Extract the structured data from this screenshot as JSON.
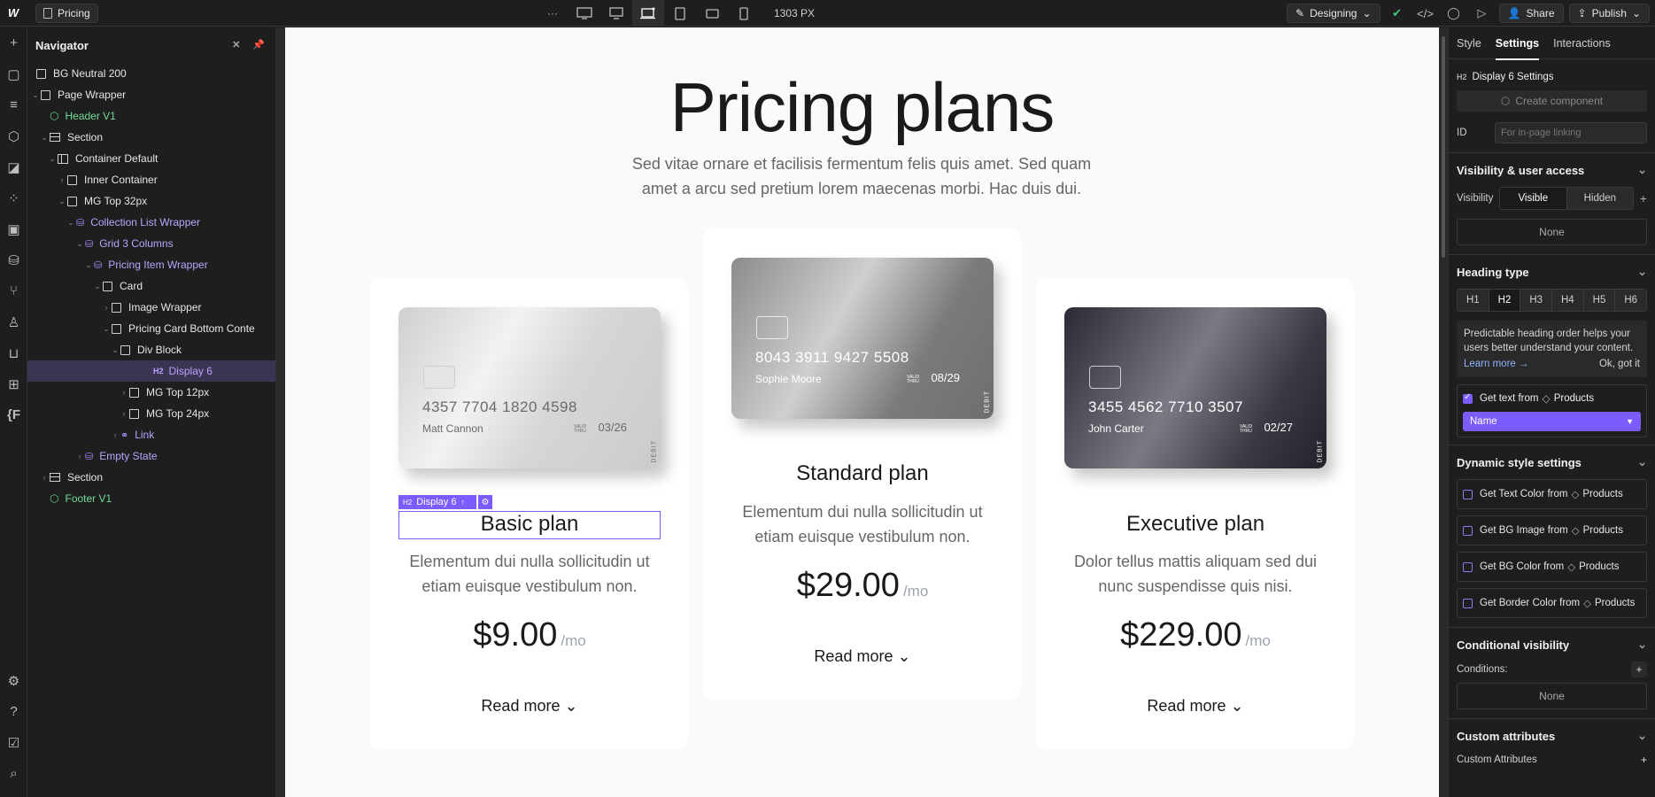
{
  "topbar": {
    "page_name": "Pricing",
    "more": "···",
    "width_readout": "1303 PX",
    "mode_label": "Designing",
    "share_label": "Share",
    "publish_label": "Publish"
  },
  "navigator": {
    "title": "Navigator",
    "rows": [
      {
        "label": "BG Neutral 200"
      },
      {
        "label": "Page Wrapper"
      },
      {
        "label": "Header V1"
      },
      {
        "label": "Section"
      },
      {
        "label": "Container Default"
      },
      {
        "label": "Inner Container"
      },
      {
        "label": "MG Top 32px"
      },
      {
        "label": "Collection List Wrapper"
      },
      {
        "label": "Grid 3 Columns"
      },
      {
        "label": "Pricing Item Wrapper"
      },
      {
        "label": "Card"
      },
      {
        "label": "Image Wrapper"
      },
      {
        "label": "Pricing Card Bottom Conte"
      },
      {
        "label": "Div Block"
      },
      {
        "label": "Display 6",
        "tag": "H2"
      },
      {
        "label": "MG Top 12px"
      },
      {
        "label": "MG Top 24px"
      },
      {
        "label": "Link"
      },
      {
        "label": "Empty State"
      },
      {
        "label": "Section"
      },
      {
        "label": "Footer V1"
      }
    ]
  },
  "canvas": {
    "title": "Pricing plans",
    "subtitle": "Sed vitae ornare et facilisis fermentum felis quis amet. Sed quam amet a arcu sed pretium lorem maecenas morbi. Hac duis dui.",
    "selection_tag": "Display 6",
    "selection_h": "H2",
    "read_more": "Read more",
    "plans": [
      {
        "name": "Basic plan",
        "description": "Elementum dui nulla sollicitudin ut etiam euisque vestibulum non.",
        "price": "$9.00",
        "period": "/mo",
        "card_number": "4357 7704 1820 4598",
        "card_holder": "Matt Cannon",
        "card_expiry": "03/26",
        "valid_thru": "VALID THRU",
        "card_type": "DEBIT"
      },
      {
        "name": "Standard plan",
        "description": "Elementum dui nulla sollicitudin ut etiam euisque vestibulum non.",
        "price": "$29.00",
        "period": "/mo",
        "card_number": "8043 3911 9427 5508",
        "card_holder": "Sophie Moore",
        "card_expiry": "08/29",
        "valid_thru": "VALID THRU",
        "card_type": "DEBIT"
      },
      {
        "name": "Executive plan",
        "description": "Dolor tellus mattis aliquam sed dui nunc suspendisse quis nisi.",
        "price": "$229.00",
        "period": "/mo",
        "card_number": "3455 4562 7710 3507",
        "card_holder": "John Carter",
        "card_expiry": "02/27",
        "valid_thru": "VALID THRU",
        "card_type": "DEBIT"
      }
    ]
  },
  "settings": {
    "tabs": [
      "Style",
      "Settings",
      "Interactions"
    ],
    "element_tag": "H2",
    "element_title": "Display 6 Settings",
    "create_component": "Create component",
    "id_label": "ID",
    "id_placeholder": "For in-page linking",
    "visibility_section": "Visibility & user access",
    "visibility_label": "Visibility",
    "visible": "Visible",
    "hidden": "Hidden",
    "none": "None",
    "heading_type": "Heading type",
    "heading_levels": [
      "H1",
      "H2",
      "H3",
      "H4",
      "H5",
      "H6"
    ],
    "heading_tip": "Predictable heading order helps your users better understand your content.",
    "learn_more": "Learn more →",
    "ok_got_it": "Ok, got it",
    "get_text_from": "Get text from",
    "products": "Products",
    "field_value": "Name",
    "dynamic_section": "Dynamic style settings",
    "dynamic_items": [
      {
        "label": "Get Text Color from"
      },
      {
        "label": "Get BG Image from"
      },
      {
        "label": "Get BG Color from"
      },
      {
        "label": "Get Border Color from"
      }
    ],
    "conditional_section": "Conditional visibility",
    "conditions_label": "Conditions:",
    "conditions_none": "None",
    "custom_attrs_section": "Custom attributes",
    "custom_attrs_label": "Custom Attributes"
  },
  "colors": {
    "accent": "#7c5cff",
    "component_green": "#6fdc96",
    "binding_purple": "#b9a5ff"
  }
}
